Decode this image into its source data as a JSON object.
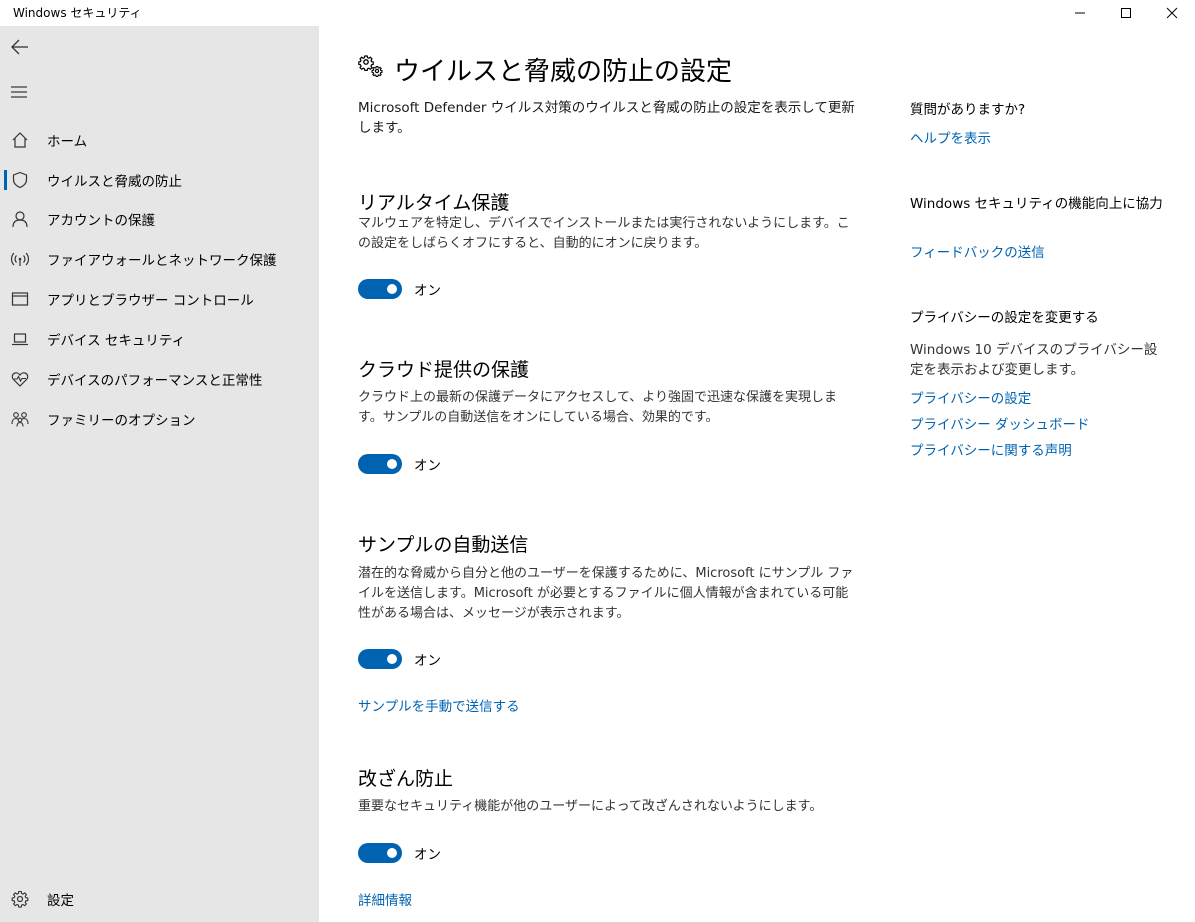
{
  "window": {
    "title": "Windows セキュリティ",
    "minimize_icon": "minimize-icon",
    "maximize_icon": "maximize-icon",
    "close_icon": "close-icon"
  },
  "sidebar": {
    "back_icon": "back-arrow-icon",
    "menu_icon": "hamburger-icon",
    "items": [
      {
        "label": "ホーム",
        "icon": "home-icon"
      },
      {
        "label": "ウイルスと脅威の防止",
        "icon": "shield-icon",
        "selected": true
      },
      {
        "label": "アカウントの保護",
        "icon": "person-icon"
      },
      {
        "label": "ファイアウォールとネットワーク保護",
        "icon": "wireless-icon"
      },
      {
        "label": "アプリとブラウザー コントロール",
        "icon": "app-window-icon"
      },
      {
        "label": "デバイス セキュリティ",
        "icon": "laptop-icon"
      },
      {
        "label": "デバイスのパフォーマンスと正常性",
        "icon": "heart-pulse-icon"
      },
      {
        "label": "ファミリーのオプション",
        "icon": "family-icon"
      }
    ],
    "settings_label": "設定",
    "accent_color": "#0063b1"
  },
  "main": {
    "title": "ウイルスと脅威の防止の設定",
    "title_icon": "gears-icon",
    "description": "Microsoft Defender ウイルス対策のウイルスと脅威の防止の設定を表示して更新します。",
    "sections": [
      {
        "title": "リアルタイム保護",
        "description": "マルウェアを特定し、デバイスでインストールまたは実行されないようにします。この設定をしばらくオフにすると、自動的にオンに戻ります。",
        "toggle_label": "オン",
        "toggle_on": true
      },
      {
        "title": "クラウド提供の保護",
        "description": "クラウド上の最新の保護データにアクセスして、より強固で迅速な保護を実現します。サンプルの自動送信をオンにしている場合、効果的です。",
        "toggle_label": "オン",
        "toggle_on": true
      },
      {
        "title": "サンプルの自動送信",
        "description": "潜在的な脅威から自分と他のユーザーを保護するために、Microsoft にサンプル ファイルを送信します。Microsoft が必要とするファイルに個人情報が含まれている可能性がある場合は、メッセージが表示されます。",
        "toggle_label": "オン",
        "toggle_on": true,
        "link": "サンプルを手動で送信する"
      },
      {
        "title": "改ざん防止",
        "description": "重要なセキュリティ機能が他のユーザーによって改ざんされないようにします。",
        "toggle_label": "オン",
        "toggle_on": true,
        "link": "詳細情報"
      }
    ]
  },
  "right": {
    "help_heading": "質問がありますか?",
    "help_link": "ヘルプを表示",
    "feedback_heading": "Windows セキュリティの機能向上に協力",
    "feedback_link": "フィードバックの送信",
    "privacy_heading": "プライバシーの設定を変更する",
    "privacy_text": "Windows 10 デバイスのプライバシー設定を表示および変更します。",
    "privacy_links": [
      "プライバシーの設定",
      "プライバシー ダッシュボード",
      "プライバシーに関する声明"
    ]
  }
}
